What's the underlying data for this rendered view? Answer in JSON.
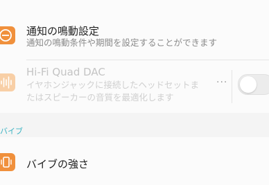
{
  "colors": {
    "accent_orange": "#f0903c",
    "disabled_orange": "#f8cfa6",
    "section_header": "#3bb3c3",
    "background": "#f4f4f4",
    "card": "#fbfbfb"
  },
  "notification_item": {
    "icon": "minus-circle-icon",
    "title": "通知の鳴動設定",
    "subtitle": "通知の鳴動条件や期間を設定することができます"
  },
  "hifi_item": {
    "icon": "audio-wave-icon",
    "title": "Hi-Fi Quad DAC",
    "subtitle_line1": "イヤホンジャックに接続したヘッドセットま",
    "subtitle_line2": "たはスピーカーの音質を最適化します",
    "more_label": "···",
    "toggle_state": "off"
  },
  "vibration_section": {
    "header": "バイブ"
  },
  "vibration_item": {
    "icon": "vibrate-phone-icon",
    "title": "バイブの強さ"
  }
}
